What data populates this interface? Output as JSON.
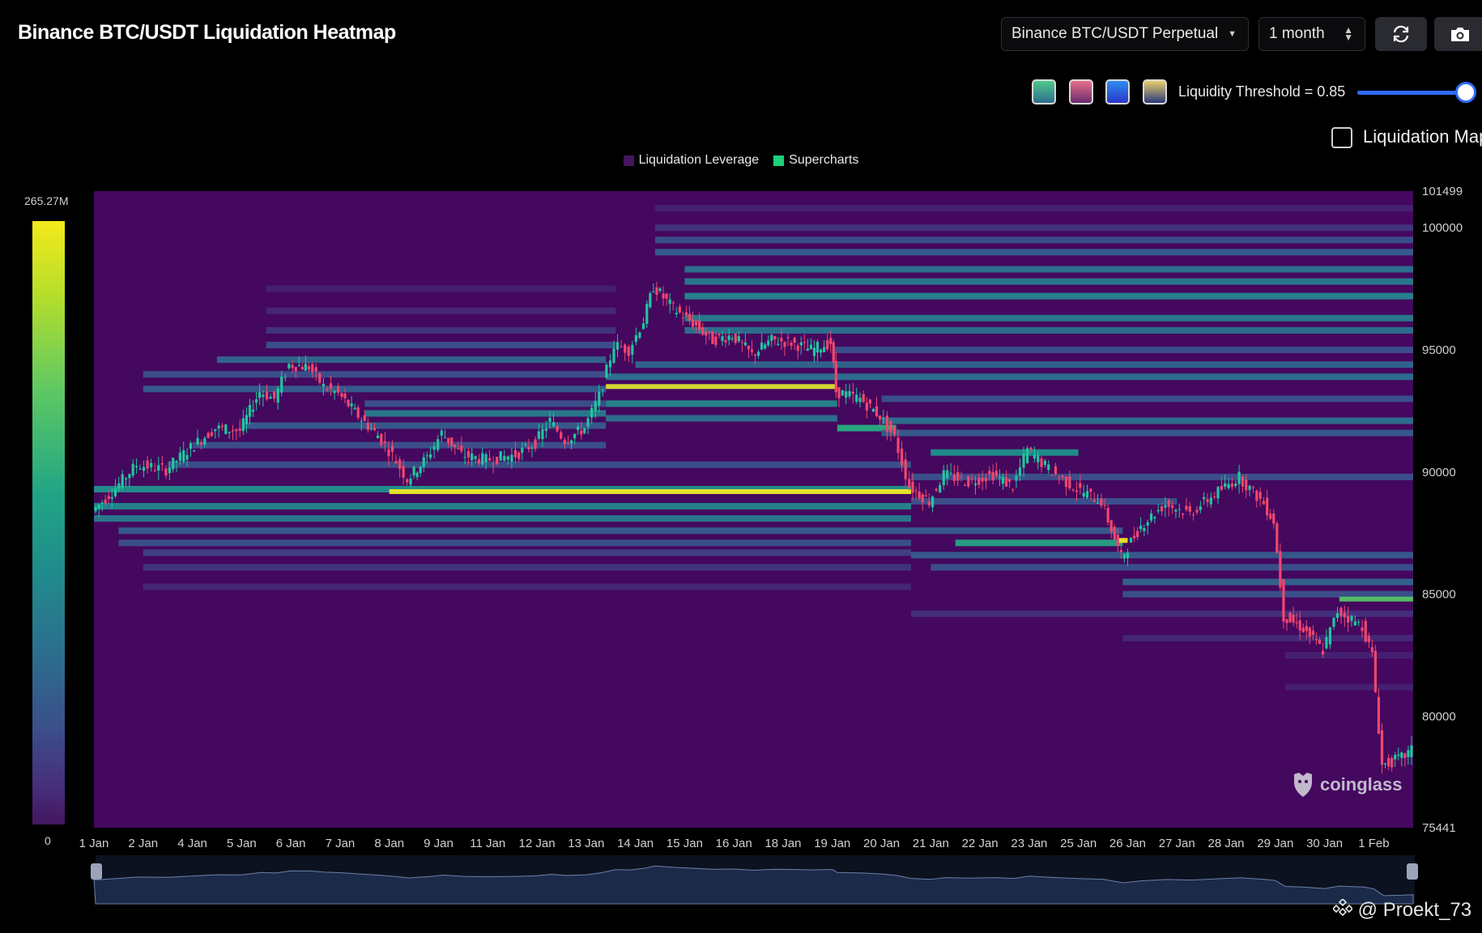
{
  "header": {
    "title": "Binance BTC/USDT Liquidation Heatmap",
    "pair_select": "Binance BTC/USDT Perpetual",
    "range_select": "1 month",
    "refresh_icon": "refresh-icon",
    "camera_icon": "camera-icon"
  },
  "controls": {
    "palettes": [
      {
        "name": "palette-viridis",
        "top": "#4fc98a",
        "bottom": "#2d6e8e"
      },
      {
        "name": "palette-sunset",
        "top": "#e8708a",
        "bottom": "#6a2a6e"
      },
      {
        "name": "palette-blue",
        "top": "#2e8cf0",
        "bottom": "#2a36c8"
      },
      {
        "name": "palette-gold",
        "top": "#e8cf6a",
        "bottom": "#2a3a7a"
      }
    ],
    "threshold_label": "Liquidity Threshold = 0.85",
    "threshold_value": 0.85,
    "liquidation_map_label": "Liquidation Map",
    "liquidation_map_checked": false
  },
  "legend": [
    {
      "label": "Liquidation Leverage",
      "color": "#44165f"
    },
    {
      "label": "Supercharts",
      "color": "#1fcf7a"
    }
  ],
  "colorbar": {
    "max_label": "265.27M",
    "min_label": "0"
  },
  "watermark": "coinglass",
  "credit": "@ Proekt_73",
  "colors": {
    "background": "#44085e",
    "up_candle": "#1fc7a0",
    "down_candle": "#f0466e",
    "navigator_fill": "#1c2a4a",
    "navigator_line": "#6b7fa6"
  },
  "chart_data": {
    "type": "heatmap",
    "ylim": [
      75441,
      101499
    ],
    "y_ticks": [
      "101499",
      "100000",
      "95000",
      "90000",
      "85000",
      "80000",
      "75441"
    ],
    "y_tick_values": [
      101499,
      100000,
      95000,
      90000,
      85000,
      80000,
      75441
    ],
    "x_ticks": [
      "1 Jan",
      "2 Jan",
      "4 Jan",
      "5 Jan",
      "6 Jan",
      "7 Jan",
      "8 Jan",
      "9 Jan",
      "11 Jan",
      "12 Jan",
      "13 Jan",
      "14 Jan",
      "15 Jan",
      "16 Jan",
      "18 Jan",
      "19 Jan",
      "20 Jan",
      "21 Jan",
      "22 Jan",
      "23 Jan",
      "25 Jan",
      "26 Jan",
      "27 Jan",
      "28 Jan",
      "29 Jan",
      "30 Jan",
      "1 Feb"
    ],
    "x_days": [
      0,
      1,
      2,
      3,
      4,
      5,
      6,
      7,
      8,
      9,
      10,
      11,
      12,
      13,
      14,
      15,
      16,
      17,
      18,
      19,
      20,
      21,
      22,
      23,
      24,
      25,
      26
    ],
    "price_path": [
      [
        0,
        88400
      ],
      [
        0.4,
        89200
      ],
      [
        0.9,
        90300
      ],
      [
        1.5,
        90100
      ],
      [
        2.0,
        91000
      ],
      [
        2.5,
        91800
      ],
      [
        3.0,
        91700
      ],
      [
        3.4,
        93300
      ],
      [
        3.7,
        93000
      ],
      [
        4.0,
        94400
      ],
      [
        4.4,
        94300
      ],
      [
        4.7,
        93500
      ],
      [
        5.0,
        93200
      ],
      [
        5.4,
        92300
      ],
      [
        5.8,
        91500
      ],
      [
        6.1,
        90700
      ],
      [
        6.4,
        89700
      ],
      [
        6.8,
        90600
      ],
      [
        7.1,
        91600
      ],
      [
        7.5,
        90700
      ],
      [
        8.0,
        90500
      ],
      [
        8.6,
        90700
      ],
      [
        9.0,
        91200
      ],
      [
        9.3,
        92100
      ],
      [
        9.6,
        91300
      ],
      [
        10.0,
        91800
      ],
      [
        10.3,
        93100
      ],
      [
        10.6,
        95200
      ],
      [
        10.9,
        95000
      ],
      [
        11.2,
        96200
      ],
      [
        11.4,
        97600
      ],
      [
        11.8,
        96700
      ],
      [
        12.2,
        96100
      ],
      [
        12.6,
        95400
      ],
      [
        13.0,
        95600
      ],
      [
        13.4,
        94800
      ],
      [
        13.8,
        95400
      ],
      [
        14.2,
        95300
      ],
      [
        14.6,
        95000
      ],
      [
        15.0,
        95300
      ],
      [
        15.1,
        93300
      ],
      [
        15.6,
        93000
      ],
      [
        16.0,
        92300
      ],
      [
        16.3,
        91400
      ],
      [
        16.6,
        89400
      ],
      [
        17.0,
        88800
      ],
      [
        17.3,
        89900
      ],
      [
        17.8,
        89600
      ],
      [
        18.3,
        89900
      ],
      [
        18.7,
        89400
      ],
      [
        19.0,
        90900
      ],
      [
        19.5,
        90000
      ],
      [
        20.0,
        89300
      ],
      [
        20.5,
        88800
      ],
      [
        20.9,
        86500
      ],
      [
        21.3,
        87800
      ],
      [
        21.8,
        88700
      ],
      [
        22.3,
        88300
      ],
      [
        22.8,
        89100
      ],
      [
        23.3,
        89800
      ],
      [
        23.8,
        88700
      ],
      [
        24.0,
        88000
      ],
      [
        24.2,
        84100
      ],
      [
        24.6,
        83600
      ],
      [
        25.0,
        82700
      ],
      [
        25.3,
        84300
      ],
      [
        25.8,
        83700
      ],
      [
        26.0,
        82500
      ],
      [
        26.2,
        78000
      ],
      [
        26.6,
        78300
      ],
      [
        26.8,
        78600
      ]
    ],
    "bands": [
      {
        "y": 89300,
        "x0": 0,
        "x1": 16.6,
        "intensity": 0.6
      },
      {
        "y": 89200,
        "x0": 6.0,
        "x1": 16.6,
        "intensity": 1.0
      },
      {
        "y": 88600,
        "x0": 0,
        "x1": 16.6,
        "intensity": 0.55
      },
      {
        "y": 88100,
        "x0": 0,
        "x1": 16.6,
        "intensity": 0.5
      },
      {
        "y": 87600,
        "x0": 0.5,
        "x1": 16.6,
        "intensity": 0.35
      },
      {
        "y": 87100,
        "x0": 0.5,
        "x1": 16.6,
        "intensity": 0.3
      },
      {
        "y": 86700,
        "x0": 1.0,
        "x1": 16.6,
        "intensity": 0.25
      },
      {
        "y": 86100,
        "x0": 1.0,
        "x1": 16.6,
        "intensity": 0.2
      },
      {
        "y": 85300,
        "x0": 1.0,
        "x1": 16.6,
        "intensity": 0.15
      },
      {
        "y": 90300,
        "x0": 1.5,
        "x1": 16.6,
        "intensity": 0.3
      },
      {
        "y": 91100,
        "x0": 2.0,
        "x1": 10.4,
        "intensity": 0.3
      },
      {
        "y": 91900,
        "x0": 3.0,
        "x1": 10.4,
        "intensity": 0.35
      },
      {
        "y": 92400,
        "x0": 5.5,
        "x1": 10.4,
        "intensity": 0.5
      },
      {
        "y": 92800,
        "x0": 5.5,
        "x1": 10.4,
        "intensity": 0.3
      },
      {
        "y": 93400,
        "x0": 1.0,
        "x1": 10.4,
        "intensity": 0.35
      },
      {
        "y": 94000,
        "x0": 1.0,
        "x1": 10.4,
        "intensity": 0.3
      },
      {
        "y": 94600,
        "x0": 2.5,
        "x1": 10.4,
        "intensity": 0.4
      },
      {
        "y": 95200,
        "x0": 3.5,
        "x1": 10.6,
        "intensity": 0.3
      },
      {
        "y": 95800,
        "x0": 3.5,
        "x1": 10.6,
        "intensity": 0.2
      },
      {
        "y": 96600,
        "x0": 3.5,
        "x1": 10.6,
        "intensity": 0.15
      },
      {
        "y": 97500,
        "x0": 3.5,
        "x1": 10.6,
        "intensity": 0.12
      },
      {
        "y": 93500,
        "x0": 10.4,
        "x1": 15.1,
        "intensity": 0.98
      },
      {
        "y": 92800,
        "x0": 10.4,
        "x1": 15.1,
        "intensity": 0.55
      },
      {
        "y": 92200,
        "x0": 10.4,
        "x1": 15.1,
        "intensity": 0.45
      },
      {
        "y": 91800,
        "x0": 15.1,
        "x1": 16.3,
        "intensity": 0.75
      },
      {
        "y": 93900,
        "x0": 10.4,
        "x1": 26.8,
        "intensity": 0.45
      },
      {
        "y": 94400,
        "x0": 11.0,
        "x1": 26.8,
        "intensity": 0.4
      },
      {
        "y": 95000,
        "x0": 15.0,
        "x1": 26.8,
        "intensity": 0.3
      },
      {
        "y": 95800,
        "x0": 12.0,
        "x1": 26.8,
        "intensity": 0.45
      },
      {
        "y": 96300,
        "x0": 12.0,
        "x1": 26.8,
        "intensity": 0.5
      },
      {
        "y": 97200,
        "x0": 12.0,
        "x1": 26.8,
        "intensity": 0.55
      },
      {
        "y": 97800,
        "x0": 12.0,
        "x1": 26.8,
        "intensity": 0.5
      },
      {
        "y": 98300,
        "x0": 12.0,
        "x1": 26.8,
        "intensity": 0.45
      },
      {
        "y": 99000,
        "x0": 11.4,
        "x1": 26.8,
        "intensity": 0.35
      },
      {
        "y": 99500,
        "x0": 11.4,
        "x1": 26.8,
        "intensity": 0.3
      },
      {
        "y": 100000,
        "x0": 11.4,
        "x1": 26.8,
        "intensity": 0.2
      },
      {
        "y": 100800,
        "x0": 11.4,
        "x1": 26.8,
        "intensity": 0.12
      },
      {
        "y": 93000,
        "x0": 16.0,
        "x1": 26.8,
        "intensity": 0.3
      },
      {
        "y": 92100,
        "x0": 16.0,
        "x1": 26.8,
        "intensity": 0.45
      },
      {
        "y": 91600,
        "x0": 16.0,
        "x1": 26.8,
        "intensity": 0.35
      },
      {
        "y": 90800,
        "x0": 17.0,
        "x1": 20.0,
        "intensity": 0.6
      },
      {
        "y": 89800,
        "x0": 16.6,
        "x1": 26.8,
        "intensity": 0.3
      },
      {
        "y": 88800,
        "x0": 16.6,
        "x1": 22.0,
        "intensity": 0.3
      },
      {
        "y": 87600,
        "x0": 16.6,
        "x1": 20.9,
        "intensity": 0.35
      },
      {
        "y": 87100,
        "x0": 17.5,
        "x1": 20.9,
        "intensity": 0.7
      },
      {
        "y": 87200,
        "x0": 20.8,
        "x1": 21.0,
        "intensity": 1.0
      },
      {
        "y": 86600,
        "x0": 16.6,
        "x1": 26.8,
        "intensity": 0.35
      },
      {
        "y": 86100,
        "x0": 17.0,
        "x1": 26.8,
        "intensity": 0.3
      },
      {
        "y": 85500,
        "x0": 20.9,
        "x1": 26.8,
        "intensity": 0.4
      },
      {
        "y": 85000,
        "x0": 20.9,
        "x1": 26.8,
        "intensity": 0.3
      },
      {
        "y": 84800,
        "x0": 25.3,
        "x1": 26.8,
        "intensity": 0.85
      },
      {
        "y": 84200,
        "x0": 16.6,
        "x1": 26.8,
        "intensity": 0.18
      },
      {
        "y": 83200,
        "x0": 20.9,
        "x1": 26.8,
        "intensity": 0.15
      },
      {
        "y": 82500,
        "x0": 24.2,
        "x1": 26.8,
        "intensity": 0.12
      },
      {
        "y": 81200,
        "x0": 24.2,
        "x1": 26.8,
        "intensity": 0.12
      }
    ]
  }
}
